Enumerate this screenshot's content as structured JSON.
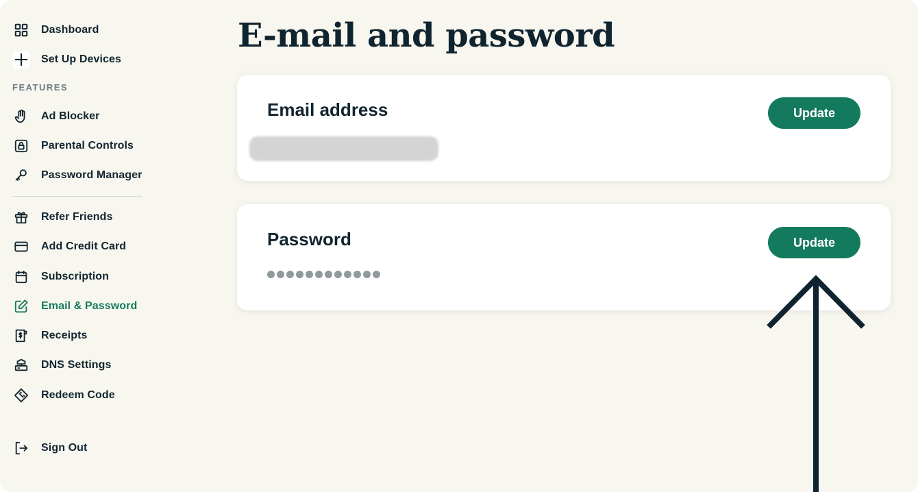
{
  "sidebar": {
    "top_items": [
      {
        "label": "Dashboard",
        "icon": "grid-icon"
      },
      {
        "label": "Set Up Devices",
        "icon": "plus-icon"
      }
    ],
    "features_heading": "FEATURES",
    "feature_items": [
      {
        "label": "Ad Blocker",
        "icon": "hand-icon"
      },
      {
        "label": "Parental Controls",
        "icon": "lock-icon"
      },
      {
        "label": "Password Manager",
        "icon": "key-icon"
      }
    ],
    "account_items": [
      {
        "label": "Refer Friends",
        "icon": "gift-icon"
      },
      {
        "label": "Add Credit Card",
        "icon": "credit-card-icon"
      },
      {
        "label": "Subscription",
        "icon": "calendar-icon"
      },
      {
        "label": "Email & Password",
        "icon": "edit-icon",
        "active": true
      },
      {
        "label": "Receipts",
        "icon": "receipt-icon"
      },
      {
        "label": "DNS Settings",
        "icon": "dns-icon"
      },
      {
        "label": "Redeem Code",
        "icon": "ticket-icon"
      }
    ],
    "sign_out": {
      "label": "Sign Out",
      "icon": "sign-out-icon"
    }
  },
  "main": {
    "title": "E-mail and password",
    "email_card": {
      "title": "Email address",
      "button": "Update"
    },
    "password_card": {
      "title": "Password",
      "button": "Update",
      "masked_length": 12
    }
  },
  "colors": {
    "background": "#f7f6ef",
    "accent": "#147a5e",
    "text": "#12252f"
  }
}
